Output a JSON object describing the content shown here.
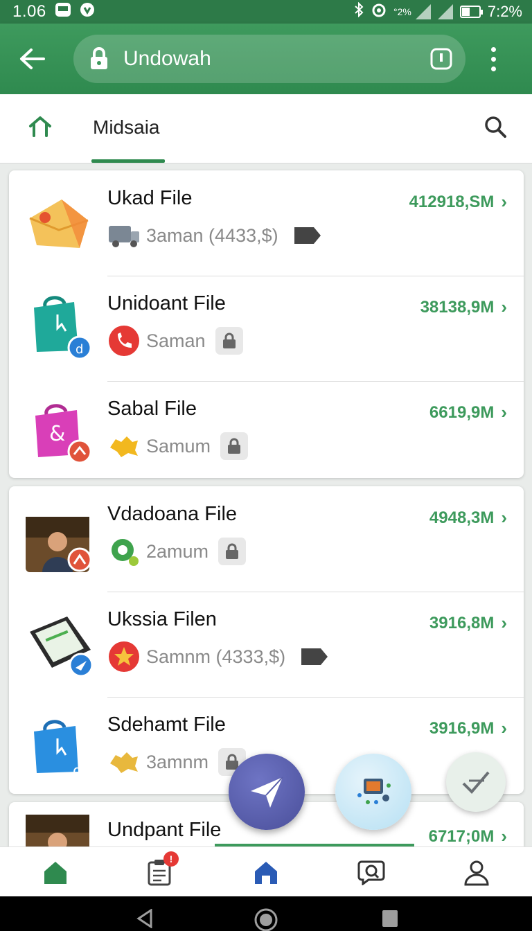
{
  "status_bar": {
    "time": "1.06",
    "network_label": "°2%",
    "battery_text": "7:2%"
  },
  "app_bar": {
    "url_text": "Undowah"
  },
  "tab_bar": {
    "title": "Midsaia"
  },
  "cards": [
    {
      "items": [
        {
          "name": "Ukad File",
          "meta": "3aman (4433,$)",
          "size": "412918,SM",
          "thumb": "envelope-icon",
          "meta_icon": "truck-icon",
          "tag": "tag-icon"
        },
        {
          "name": "Unidoant File",
          "meta": "Saman",
          "size": "38138,9M",
          "thumb": "teal-bag-icon",
          "meta_icon": "phone-icon",
          "tag": "lock-icon"
        },
        {
          "name": "Sabal File",
          "meta": "Samum",
          "size": "6619,9M",
          "thumb": "pink-bag-icon",
          "meta_icon": "star-burst-icon",
          "tag": "lock-icon"
        }
      ]
    },
    {
      "items": [
        {
          "name": "Vdadoana File",
          "meta": "2amum",
          "size": "4948,3M",
          "thumb": "person-photo",
          "meta_icon": "gear-icon",
          "tag": "lock-icon"
        },
        {
          "name": "Ukssia Filen",
          "meta": "Samnm (4333,$)",
          "size": "3916,8M",
          "thumb": "device-icon",
          "meta_icon": "star-icon",
          "tag": "tag-icon"
        },
        {
          "name": "Sdehamt File",
          "meta": "3amnm",
          "size": "3916,9M",
          "thumb": "blue-bag-icon",
          "meta_icon": "star-burst-icon",
          "tag": "lock-icon"
        }
      ]
    },
    {
      "items": [
        {
          "name": "Undpant File",
          "meta": "",
          "size": "6717;0M",
          "thumb": "person-photo"
        }
      ]
    }
  ],
  "colors": {
    "primary": "#2f8a4f",
    "accent_size": "#3d9a5c",
    "fab_send": "#4f55a3",
    "fab_app": "#bfe3f4"
  }
}
